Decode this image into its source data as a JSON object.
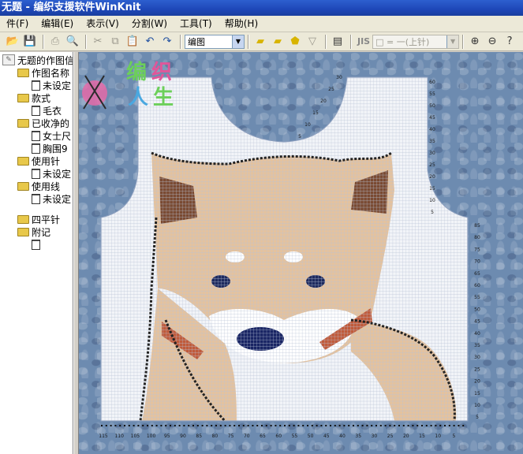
{
  "window": {
    "title": "无题 - 编织支援软件WinKnit"
  },
  "menu": [
    "件(F)",
    "编辑(E)",
    "表示(V)",
    "分割(W)",
    "工具(T)",
    "帮助(H)"
  ],
  "toolbar": {
    "mode_value": "编图",
    "jis_label": "JIS",
    "stitch_value": "□ = 一(上针)",
    "icons": [
      "open-icon",
      "save-icon",
      "print-icon",
      "print-preview-icon",
      "cut-icon",
      "copy-icon",
      "paste-icon",
      "undo-icon",
      "redo-icon"
    ]
  },
  "tree": {
    "root": "无题的作图信",
    "items": [
      {
        "type": "folder",
        "label": "作图名称",
        "depth": 1
      },
      {
        "type": "doc",
        "label": "未设定",
        "depth": 2
      },
      {
        "type": "folder",
        "label": "款式",
        "depth": 1
      },
      {
        "type": "doc",
        "label": "毛衣",
        "depth": 2
      },
      {
        "type": "folder",
        "label": "已收净的",
        "depth": 1
      },
      {
        "type": "doc",
        "label": "女士尺",
        "depth": 2
      },
      {
        "type": "doc",
        "label": "胸围9",
        "depth": 2
      },
      {
        "type": "folder",
        "label": "使用针",
        "depth": 1
      },
      {
        "type": "doc",
        "label": "未设定",
        "depth": 2
      },
      {
        "type": "folder",
        "label": "使用线",
        "depth": 1
      },
      {
        "type": "doc",
        "label": "未设定",
        "depth": 2
      },
      {
        "type": "folder",
        "label": "四平针",
        "depth": 1
      },
      {
        "type": "folder",
        "label": "附记",
        "depth": 1
      },
      {
        "type": "doc",
        "label": "",
        "depth": 2
      }
    ]
  },
  "chart": {
    "x_ticks": [
      "115",
      "110",
      "105",
      "100",
      "95",
      "90",
      "85",
      "80",
      "75",
      "70",
      "65",
      "60",
      "55",
      "50",
      "45",
      "40",
      "35",
      "30",
      "25",
      "20",
      "15",
      "10",
      "5"
    ],
    "y_ticks_right": [
      "85",
      "80",
      "75",
      "70",
      "65",
      "60",
      "55",
      "50",
      "45",
      "40",
      "35",
      "30",
      "25",
      "20",
      "15",
      "10",
      "5"
    ],
    "y_ticks_upper": [
      "60",
      "55",
      "50",
      "45",
      "40",
      "35",
      "30",
      "25",
      "20",
      "15",
      "10",
      "5"
    ],
    "y_ticks_neck": [
      "30",
      "25",
      "20",
      "15",
      "10",
      "5"
    ]
  },
  "watermark": {
    "text": "编织人生"
  },
  "colors": {
    "grid_bg": "#f2f4f8",
    "grid_line": "#b9c3d6",
    "fur": "#e4c29e",
    "ear_inner": "#7a4a32",
    "outline": "#232323",
    "eye": "#1e2a5e",
    "nose": "#182463",
    "cheek": "#c05a3a",
    "canvas_bg": "#6d8bb0"
  }
}
